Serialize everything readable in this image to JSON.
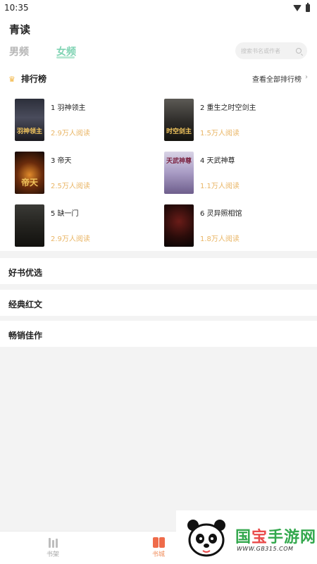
{
  "status_bar": {
    "time": "10:35"
  },
  "header": {
    "app_title": "青读",
    "tabs": [
      {
        "label": "男频",
        "active": false
      },
      {
        "label": "女频",
        "active": true
      }
    ],
    "search_placeholder": "搜索书名或作者"
  },
  "ranking": {
    "title": "排行榜",
    "view_all": "查看全部排行榜",
    "books": [
      {
        "name": "1 羽神领主",
        "reads": "2.9万人阅读",
        "cover_text": "羽神领主"
      },
      {
        "name": "2 重生之时空剑主",
        "reads": "1.5万人阅读",
        "cover_text": "时空剑主"
      },
      {
        "name": "3 帝天",
        "reads": "2.5万人阅读",
        "cover_text": "帝天"
      },
      {
        "name": "4 天武神尊",
        "reads": "1.1万人阅读",
        "cover_text": "天武神尊"
      },
      {
        "name": "5 缺一门",
        "reads": "2.9万人阅读",
        "cover_text": ""
      },
      {
        "name": "6 灵异照相馆",
        "reads": "1.8万人阅读",
        "cover_text": ""
      }
    ]
  },
  "sections": [
    {
      "label": "好书优选"
    },
    {
      "label": "经典红文"
    },
    {
      "label": "畅销佳作"
    }
  ],
  "bottom_nav": [
    {
      "label": "书架",
      "icon": "bookshelf-icon",
      "active": false
    },
    {
      "label": "书城",
      "icon": "book-store-icon",
      "active": true
    }
  ],
  "watermark": {
    "text_green": "国",
    "text_red": "宝",
    "text_rest": "手游网",
    "url": "WWW.GB315.COM"
  },
  "colors": {
    "accent_green": "#7fd3b3",
    "reads_orange": "#e9b565",
    "nav_active": "#f08c5a"
  }
}
